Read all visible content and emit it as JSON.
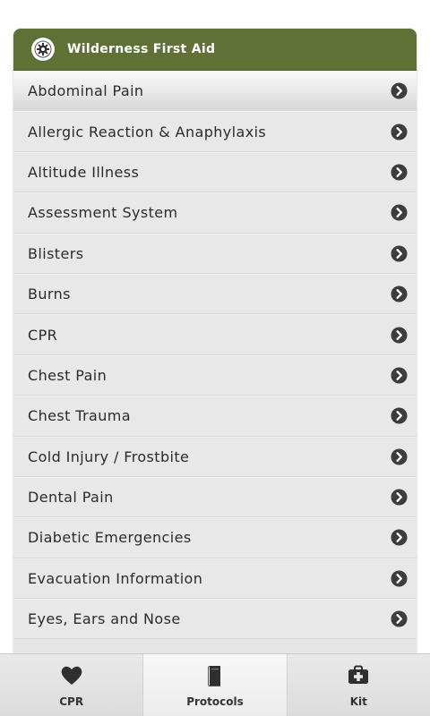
{
  "header": {
    "title": "Wilderness First Aid",
    "icon": "gear-icon"
  },
  "list": {
    "items": [
      {
        "label": "Abdominal Pain"
      },
      {
        "label": "Allergic Reaction & Anaphylaxis"
      },
      {
        "label": "Altitude Illness"
      },
      {
        "label": "Assessment System"
      },
      {
        "label": "Blisters"
      },
      {
        "label": "Burns"
      },
      {
        "label": "CPR"
      },
      {
        "label": "Chest Pain"
      },
      {
        "label": "Chest Trauma"
      },
      {
        "label": "Cold Injury / Frostbite"
      },
      {
        "label": "Dental Pain"
      },
      {
        "label": "Diabetic Emergencies"
      },
      {
        "label": "Evacuation Information"
      },
      {
        "label": "Eyes, Ears and Nose"
      }
    ]
  },
  "tabs": [
    {
      "label": "CPR",
      "icon": "heart-icon"
    },
    {
      "label": "Protocols",
      "icon": "book-icon"
    },
    {
      "label": "Kit",
      "icon": "first-aid-kit-icon"
    }
  ],
  "colors": {
    "header_bg": "#5f7134",
    "row_bg": "#e8e8e8",
    "chevron": "#3d3d3d"
  }
}
